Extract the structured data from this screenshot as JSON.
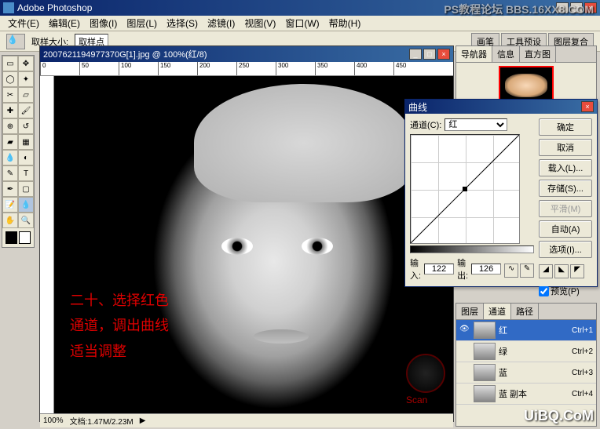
{
  "app": {
    "title": "Adobe Photoshop"
  },
  "menu": [
    "文件(E)",
    "编辑(E)",
    "图像(I)",
    "图层(L)",
    "选择(S)",
    "滤镜(I)",
    "视图(V)",
    "窗口(W)",
    "帮助(H)"
  ],
  "options": {
    "label1": "取样大小:",
    "sample_value": "取样点",
    "tabs": [
      "画笔",
      "工具预设",
      "图层复合"
    ]
  },
  "document": {
    "title": "2007621194977370G[1].jpg @ 100%(红/8)",
    "overlay_l1": "二十、选择红色",
    "overlay_l2": "通道，调出曲线",
    "overlay_l3": "适当调整",
    "scan_label": "Scan",
    "status_zoom": "100%",
    "status_size": "文档:1.47M/2.23M"
  },
  "curves": {
    "title": "曲线",
    "channel_label": "通道(C):",
    "channel_value": "红",
    "input_label": "输入:",
    "input_value": "122",
    "output_label": "输出:",
    "output_value": "126",
    "btn_ok": "确定",
    "btn_cancel": "取消",
    "btn_load": "载入(L)...",
    "btn_save": "存储(S)...",
    "btn_smooth": "平滑(M)",
    "btn_auto": "自动(A)",
    "btn_options": "选项(I)...",
    "preview": "预览(P)"
  },
  "chart_data": {
    "type": "line",
    "title": "曲线",
    "x": [
      0,
      122,
      255
    ],
    "y": [
      0,
      126,
      255
    ],
    "xlabel": "输入",
    "ylabel": "输出",
    "xlim": [
      0,
      255
    ],
    "ylim": [
      0,
      255
    ]
  },
  "navigator": {
    "tabs": [
      "导航器",
      "信息",
      "直方图"
    ]
  },
  "channels": {
    "tabs": [
      "图层",
      "通道",
      "路径"
    ],
    "items": [
      {
        "name": "红",
        "shortcut": "Ctrl+1",
        "active": true
      },
      {
        "name": "绿",
        "shortcut": "Ctrl+2",
        "active": false
      },
      {
        "name": "蓝",
        "shortcut": "Ctrl+3",
        "active": false
      },
      {
        "name": "蓝 副本",
        "shortcut": "Ctrl+4",
        "active": false
      }
    ]
  },
  "watermarks": {
    "top": "PS教程论坛\nBBS.16XX8.COM",
    "bottom": "UiBQ.CoM"
  },
  "ruler_ticks": [
    "0",
    "50",
    "100",
    "150",
    "200",
    "250",
    "300",
    "350",
    "400",
    "450"
  ]
}
